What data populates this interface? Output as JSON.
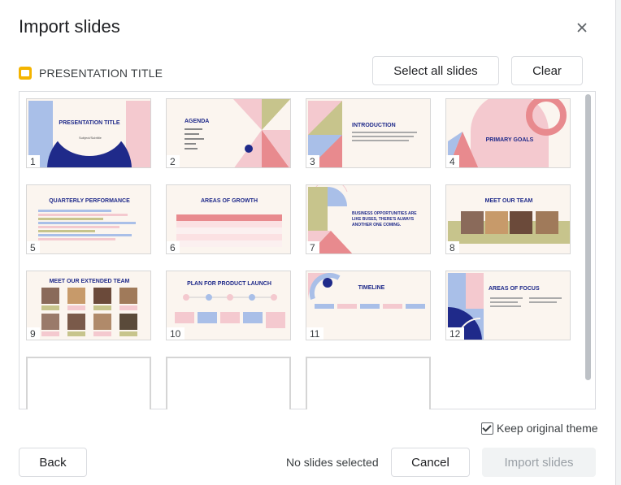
{
  "dialog": {
    "title": "Import slides"
  },
  "presentation": {
    "name": "PRESENTATION TITLE"
  },
  "toolbar": {
    "select_all": "Select all slides",
    "clear": "Clear"
  },
  "slides": [
    {
      "num": "1",
      "title": "PRESENTATION TITLE",
      "subtitle": "Subject/Subtitle"
    },
    {
      "num": "2",
      "title": "AGENDA"
    },
    {
      "num": "3",
      "title": "INTRODUCTION"
    },
    {
      "num": "4",
      "title": "PRIMARY GOALS"
    },
    {
      "num": "5",
      "title": "QUARTERLY PERFORMANCE"
    },
    {
      "num": "6",
      "title": "AREAS OF GROWTH"
    },
    {
      "num": "7",
      "title": "BUSINESS OPPORTUNITIES ARE LIKE BUSES, THERE'S ALWAYS ANOTHER ONE COMING."
    },
    {
      "num": "8",
      "title": "MEET OUR TEAM"
    },
    {
      "num": "9",
      "title": "MEET OUR EXTENDED TEAM"
    },
    {
      "num": "10",
      "title": "PLAN FOR PRODUCT LAUNCH"
    },
    {
      "num": "11",
      "title": "TIMELINE"
    },
    {
      "num": "12",
      "title": "AREAS OF FOCUS"
    }
  ],
  "footer": {
    "keep_theme": "Keep original theme",
    "back": "Back",
    "status": "No slides selected",
    "cancel": "Cancel",
    "import": "Import slides"
  }
}
